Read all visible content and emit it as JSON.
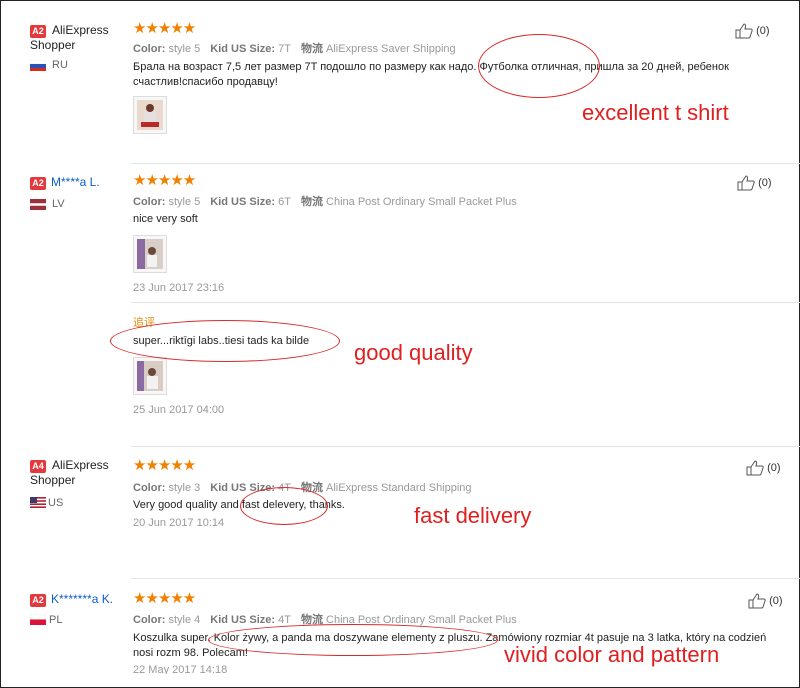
{
  "labels": {
    "color": "Color:",
    "size": "Kid US Size:",
    "shipping_cn": "物流",
    "stars": "★★★★★",
    "helpful_count": "(0)"
  },
  "reviews": [
    {
      "badge": "A2",
      "name": "AliExpress Shopper",
      "country": "RU",
      "color": "style 5",
      "size": "7T",
      "shipping": "AliExpress Saver Shipping",
      "text": "Брала на возраст 7,5 лет размер 7T подошло по размеру как надо. Футболка отличная, пришла за 20 дней, ребенок счастлив!спасибо продавцу!",
      "annotation": "excellent t shirt"
    },
    {
      "badge": "A2",
      "name": "M****a L.",
      "country": "LV",
      "color": "style 5",
      "size": "6T",
      "shipping": "China Post Ordinary Small Packet Plus",
      "text": "nice very soft",
      "date": "23 Jun 2017 23:16",
      "followup_label": "追评",
      "followup_text": "super...riktīgi labs..tiesi tads ka bilde",
      "followup_date": "25 Jun 2017 04:00",
      "annotation": "good quality"
    },
    {
      "badge": "A4",
      "name": "AliExpress Shopper",
      "country": "US",
      "color": "style 3",
      "size": "4T",
      "shipping": "AliExpress Standard Shipping",
      "text": "Very good quality and fast delevery, thanks.",
      "date": "20 Jun 2017 10:14",
      "annotation": "fast delivery"
    },
    {
      "badge": "A2",
      "name": "K*******a K.",
      "country": "PL",
      "color": "style 4",
      "size": "4T",
      "shipping": "China Post Ordinary Small Packet Plus",
      "text": "Koszulka super. Kolor żywy, a panda ma doszywane elementy z pluszu. Zamówiony rozmiar 4t pasuje na 3 latka, który na codzień nosi rozm 98. Polecam!",
      "date": "22 May 2017 14:18",
      "annotation": "vivid color and pattern"
    }
  ]
}
